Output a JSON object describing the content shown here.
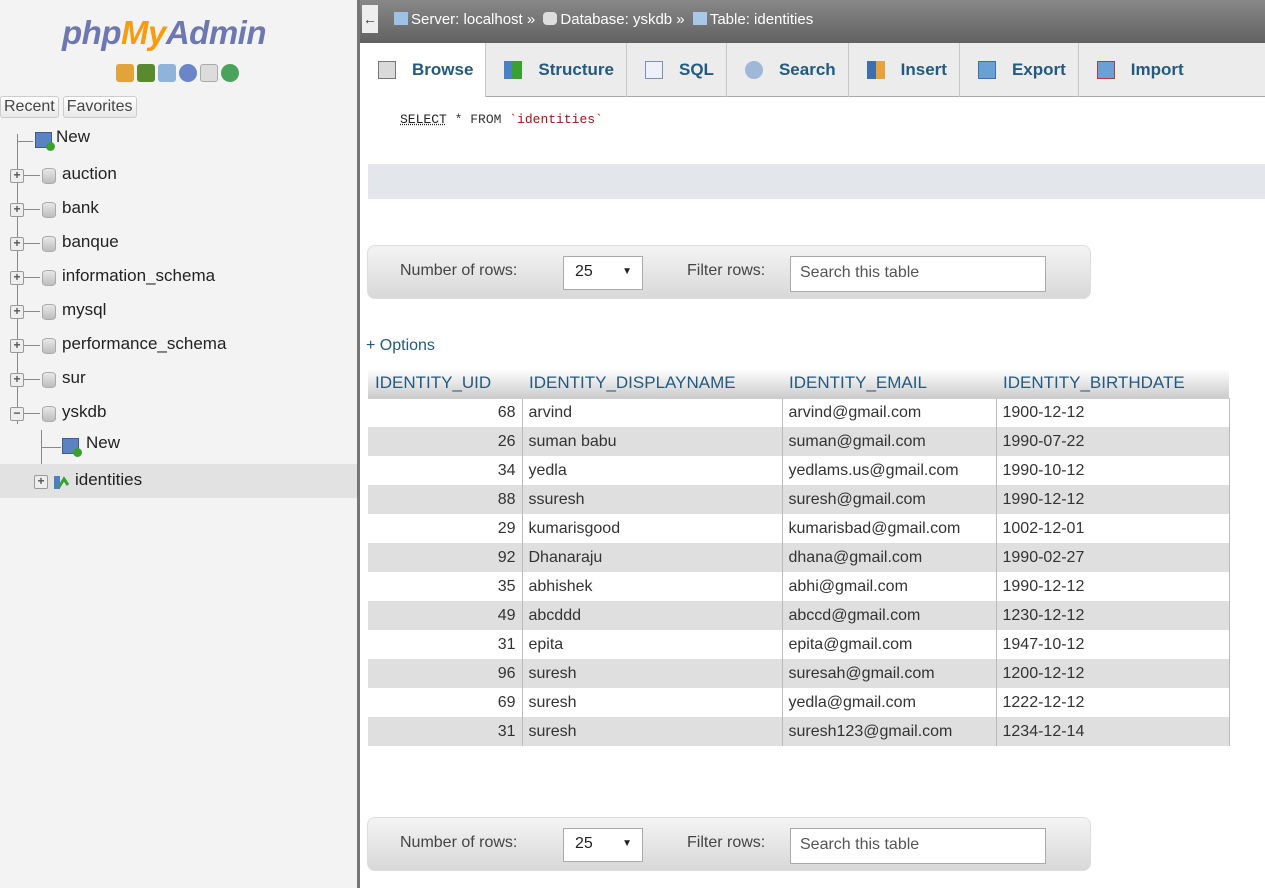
{
  "logo": {
    "part1": "php",
    "part2": "My",
    "part3": "Admin"
  },
  "nav_tabs": [
    "Recent",
    "Favorites"
  ],
  "tree": {
    "new_label": "New",
    "databases": [
      "auction",
      "bank",
      "banque",
      "information_schema",
      "mysql",
      "performance_schema",
      "sur",
      "yskdb"
    ],
    "expanded_db": {
      "new_label": "New",
      "tables": [
        "identities"
      ]
    }
  },
  "breadcrumb": {
    "server": "Server: localhost »",
    "database": "Database: yskdb »",
    "table": "Table: identities"
  },
  "menu_tabs": [
    "Browse",
    "Structure",
    "SQL",
    "Search",
    "Insert",
    "Export",
    "Import"
  ],
  "sql": {
    "keyword": "SELECT",
    "rest": " * FROM ",
    "table": "`identities`"
  },
  "navigation": {
    "rows_label": "Number of rows:",
    "rows_value": "25",
    "filter_label": "Filter rows:",
    "filter_placeholder": "Search this table"
  },
  "options_link": "+ Options",
  "table": {
    "columns": [
      "IDENTITY_UID",
      "IDENTITY_DISPLAYNAME",
      "IDENTITY_EMAIL",
      "IDENTITY_BIRTHDATE"
    ],
    "rows": [
      [
        "68",
        "arvind",
        "arvind@gmail.com",
        "1900-12-12"
      ],
      [
        "26",
        "suman babu",
        "suman@gmail.com",
        "1990-07-22"
      ],
      [
        "34",
        "yedla",
        "yedlams.us@gmail.com",
        "1990-10-12"
      ],
      [
        "88",
        "ssuresh",
        "suresh@gmail.com",
        "1990-12-12"
      ],
      [
        "29",
        "kumarisgood",
        "kumarisbad@gmail.com",
        "1002-12-01"
      ],
      [
        "92",
        "Dhanaraju",
        "dhana@gmail.com",
        "1990-02-27"
      ],
      [
        "35",
        "abhishek",
        "abhi@gmail.com",
        "1990-12-12"
      ],
      [
        "49",
        "abcddd",
        "abccd@gmail.com",
        "1230-12-12"
      ],
      [
        "31",
        "epita",
        "epita@gmail.com",
        "1947-10-12"
      ],
      [
        "96",
        "suresh",
        "suresah@gmail.com",
        "1200-12-12"
      ],
      [
        "69",
        "suresh",
        "yedla@gmail.com",
        "1222-12-12"
      ],
      [
        "31",
        "suresh",
        "suresh123@gmail.com",
        "1234-12-14"
      ]
    ]
  }
}
